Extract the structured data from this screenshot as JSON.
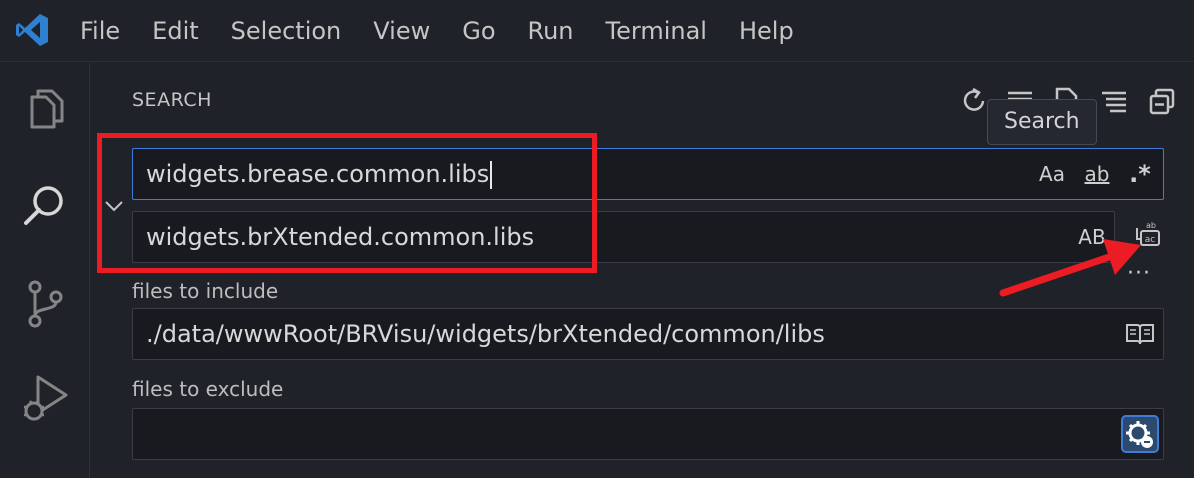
{
  "menu": {
    "items": [
      "File",
      "Edit",
      "Selection",
      "View",
      "Go",
      "Run",
      "Terminal",
      "Help"
    ]
  },
  "activity_bar": {
    "icons": [
      "explorer-icon",
      "search-icon",
      "source-control-icon",
      "run-debug-icon"
    ]
  },
  "search": {
    "title": "SEARCH",
    "tooltip": "Search",
    "query": "widgets.brease.common.libs",
    "replace": "widgets.brXtended.common.libs",
    "match_case_label": "Aa",
    "whole_word_label": "ab",
    "regex_label": ".*",
    "preserve_case_label": "AB",
    "more_label": "···",
    "files_include_label": "files to include",
    "files_include_value": "./data/wwwRoot/BRVisu/widgets/brXtended/common/libs",
    "files_exclude_label": "files to exclude",
    "files_exclude_value": ""
  },
  "colors": {
    "background": "#1f2228",
    "input_background": "#181a1f",
    "focus_border": "#3d7dd8",
    "annotation_red": "#ec1c24",
    "logo_blue": "#2f80d1"
  }
}
